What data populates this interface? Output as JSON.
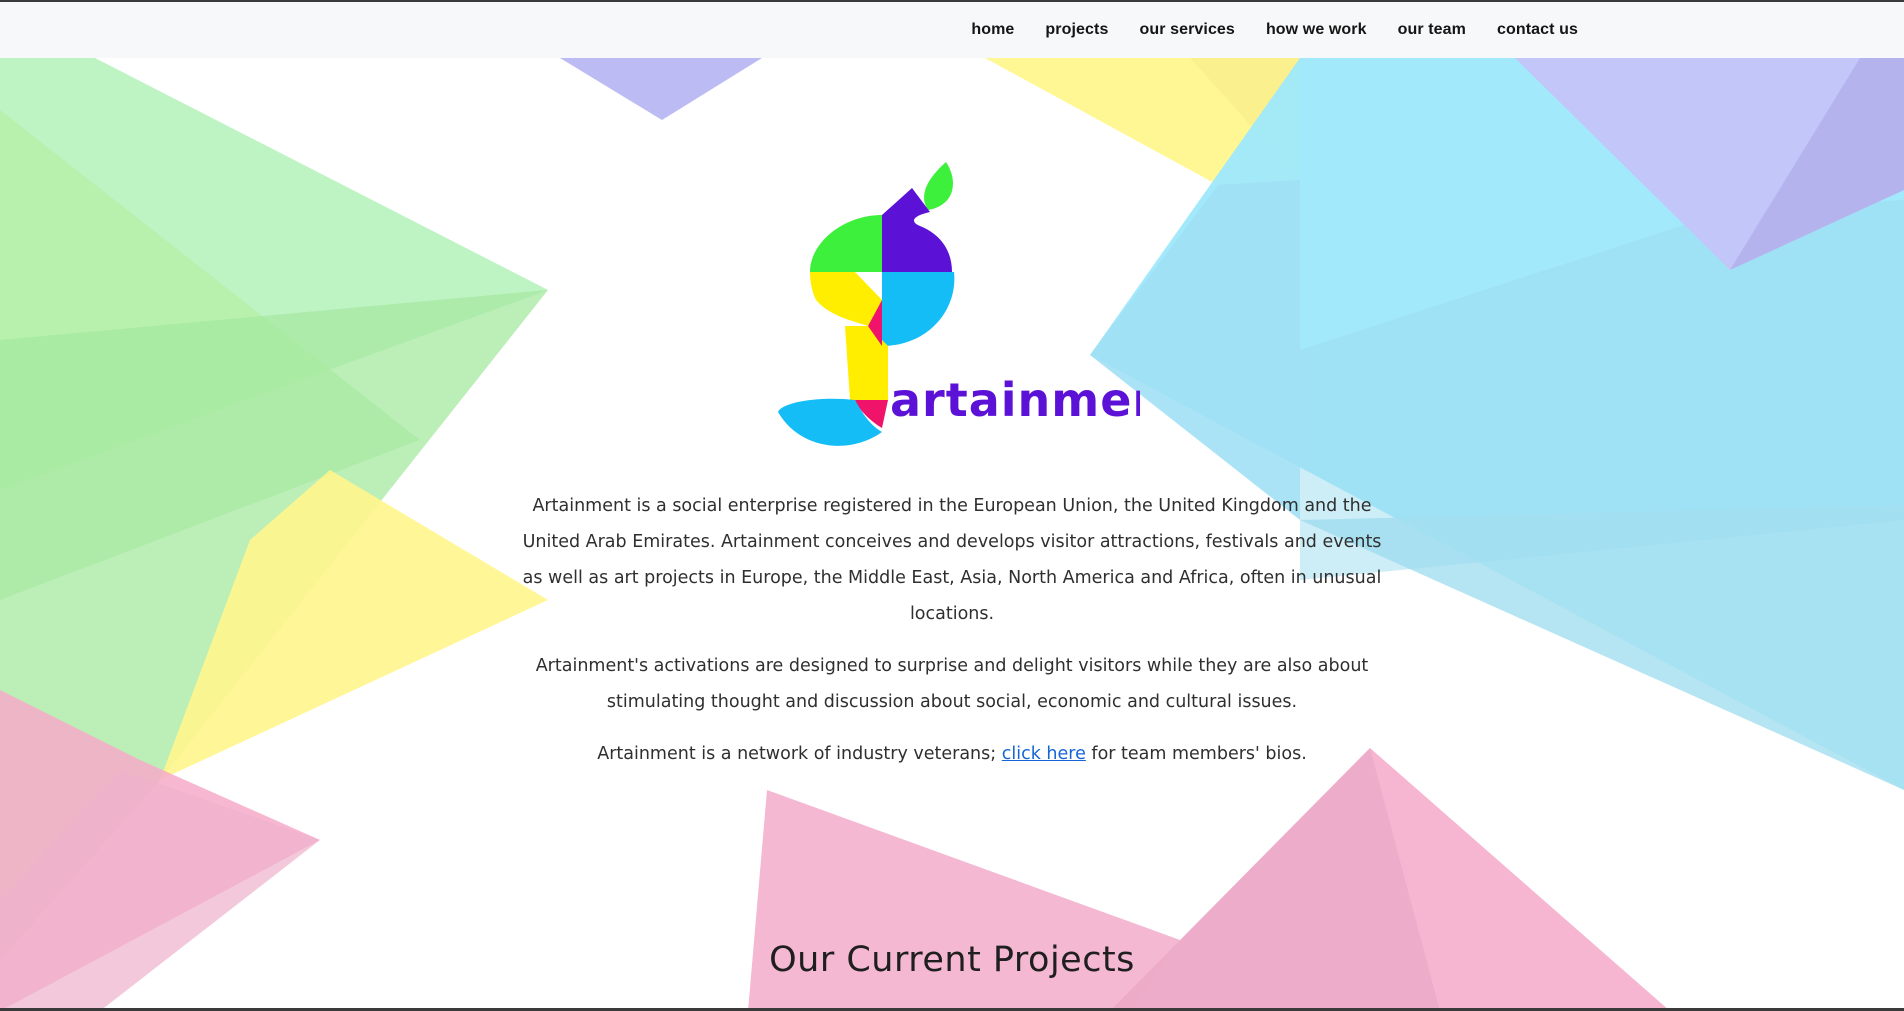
{
  "nav": {
    "items": [
      {
        "label": "home"
      },
      {
        "label": "projects"
      },
      {
        "label": "our services"
      },
      {
        "label": "how we work"
      },
      {
        "label": "our team"
      },
      {
        "label": "contact us"
      }
    ]
  },
  "logo": {
    "wordmark": "artainment"
  },
  "intro": {
    "paragraph1": "Artainment is a social enterprise registered in the European Union, the United Kingdom and the United Arab Emirates. Artainment conceives and develops visitor attractions, festivals and events as well as art projects in Europe, the Middle East, Asia, North America and Africa, often in unusual locations.",
    "paragraph2": "Artainment's activations are designed to surprise and delight visitors while they are also about stimulating thought and discussion about social, economic and cultural issues.",
    "paragraph3_before": "Artainment is a network of industry veterans; ",
    "paragraph3_link": "click here",
    "paragraph3_after": " for team members' bios."
  },
  "projects": {
    "heading": "Our Current Projects"
  },
  "colors": {
    "logo_purple": "#5b12d6",
    "logo_green": "#3cf03c",
    "logo_yellow": "#ffee00",
    "logo_cyan": "#14bdf5",
    "logo_pink": "#f0136a",
    "link": "#1565d8"
  }
}
